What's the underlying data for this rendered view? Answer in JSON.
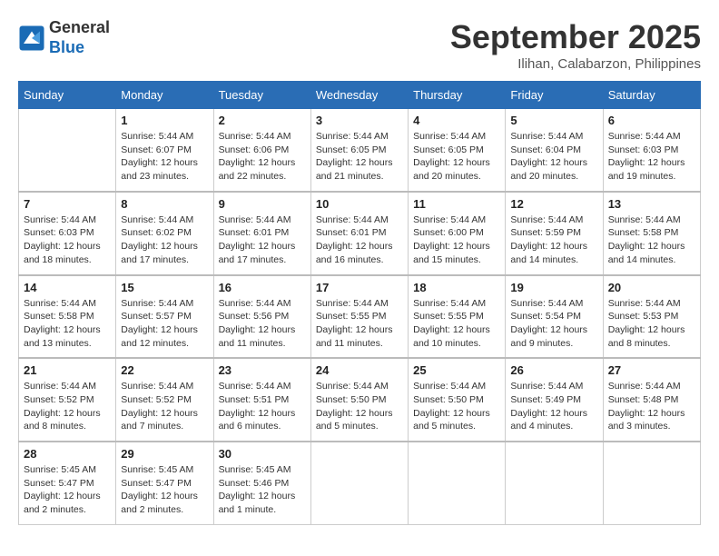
{
  "header": {
    "logo_general": "General",
    "logo_blue": "Blue",
    "month_title": "September 2025",
    "location": "Ilihan, Calabarzon, Philippines"
  },
  "columns": [
    "Sunday",
    "Monday",
    "Tuesday",
    "Wednesday",
    "Thursday",
    "Friday",
    "Saturday"
  ],
  "weeks": [
    [
      {
        "day": "",
        "info": ""
      },
      {
        "day": "1",
        "info": "Sunrise: 5:44 AM\nSunset: 6:07 PM\nDaylight: 12 hours\nand 23 minutes."
      },
      {
        "day": "2",
        "info": "Sunrise: 5:44 AM\nSunset: 6:06 PM\nDaylight: 12 hours\nand 22 minutes."
      },
      {
        "day": "3",
        "info": "Sunrise: 5:44 AM\nSunset: 6:05 PM\nDaylight: 12 hours\nand 21 minutes."
      },
      {
        "day": "4",
        "info": "Sunrise: 5:44 AM\nSunset: 6:05 PM\nDaylight: 12 hours\nand 20 minutes."
      },
      {
        "day": "5",
        "info": "Sunrise: 5:44 AM\nSunset: 6:04 PM\nDaylight: 12 hours\nand 20 minutes."
      },
      {
        "day": "6",
        "info": "Sunrise: 5:44 AM\nSunset: 6:03 PM\nDaylight: 12 hours\nand 19 minutes."
      }
    ],
    [
      {
        "day": "7",
        "info": "Sunrise: 5:44 AM\nSunset: 6:03 PM\nDaylight: 12 hours\nand 18 minutes."
      },
      {
        "day": "8",
        "info": "Sunrise: 5:44 AM\nSunset: 6:02 PM\nDaylight: 12 hours\nand 17 minutes."
      },
      {
        "day": "9",
        "info": "Sunrise: 5:44 AM\nSunset: 6:01 PM\nDaylight: 12 hours\nand 17 minutes."
      },
      {
        "day": "10",
        "info": "Sunrise: 5:44 AM\nSunset: 6:01 PM\nDaylight: 12 hours\nand 16 minutes."
      },
      {
        "day": "11",
        "info": "Sunrise: 5:44 AM\nSunset: 6:00 PM\nDaylight: 12 hours\nand 15 minutes."
      },
      {
        "day": "12",
        "info": "Sunrise: 5:44 AM\nSunset: 5:59 PM\nDaylight: 12 hours\nand 14 minutes."
      },
      {
        "day": "13",
        "info": "Sunrise: 5:44 AM\nSunset: 5:58 PM\nDaylight: 12 hours\nand 14 minutes."
      }
    ],
    [
      {
        "day": "14",
        "info": "Sunrise: 5:44 AM\nSunset: 5:58 PM\nDaylight: 12 hours\nand 13 minutes."
      },
      {
        "day": "15",
        "info": "Sunrise: 5:44 AM\nSunset: 5:57 PM\nDaylight: 12 hours\nand 12 minutes."
      },
      {
        "day": "16",
        "info": "Sunrise: 5:44 AM\nSunset: 5:56 PM\nDaylight: 12 hours\nand 11 minutes."
      },
      {
        "day": "17",
        "info": "Sunrise: 5:44 AM\nSunset: 5:55 PM\nDaylight: 12 hours\nand 11 minutes."
      },
      {
        "day": "18",
        "info": "Sunrise: 5:44 AM\nSunset: 5:55 PM\nDaylight: 12 hours\nand 10 minutes."
      },
      {
        "day": "19",
        "info": "Sunrise: 5:44 AM\nSunset: 5:54 PM\nDaylight: 12 hours\nand 9 minutes."
      },
      {
        "day": "20",
        "info": "Sunrise: 5:44 AM\nSunset: 5:53 PM\nDaylight: 12 hours\nand 8 minutes."
      }
    ],
    [
      {
        "day": "21",
        "info": "Sunrise: 5:44 AM\nSunset: 5:52 PM\nDaylight: 12 hours\nand 8 minutes."
      },
      {
        "day": "22",
        "info": "Sunrise: 5:44 AM\nSunset: 5:52 PM\nDaylight: 12 hours\nand 7 minutes."
      },
      {
        "day": "23",
        "info": "Sunrise: 5:44 AM\nSunset: 5:51 PM\nDaylight: 12 hours\nand 6 minutes."
      },
      {
        "day": "24",
        "info": "Sunrise: 5:44 AM\nSunset: 5:50 PM\nDaylight: 12 hours\nand 5 minutes."
      },
      {
        "day": "25",
        "info": "Sunrise: 5:44 AM\nSunset: 5:50 PM\nDaylight: 12 hours\nand 5 minutes."
      },
      {
        "day": "26",
        "info": "Sunrise: 5:44 AM\nSunset: 5:49 PM\nDaylight: 12 hours\nand 4 minutes."
      },
      {
        "day": "27",
        "info": "Sunrise: 5:44 AM\nSunset: 5:48 PM\nDaylight: 12 hours\nand 3 minutes."
      }
    ],
    [
      {
        "day": "28",
        "info": "Sunrise: 5:45 AM\nSunset: 5:47 PM\nDaylight: 12 hours\nand 2 minutes."
      },
      {
        "day": "29",
        "info": "Sunrise: 5:45 AM\nSunset: 5:47 PM\nDaylight: 12 hours\nand 2 minutes."
      },
      {
        "day": "30",
        "info": "Sunrise: 5:45 AM\nSunset: 5:46 PM\nDaylight: 12 hours\nand 1 minute."
      },
      {
        "day": "",
        "info": ""
      },
      {
        "day": "",
        "info": ""
      },
      {
        "day": "",
        "info": ""
      },
      {
        "day": "",
        "info": ""
      }
    ]
  ]
}
